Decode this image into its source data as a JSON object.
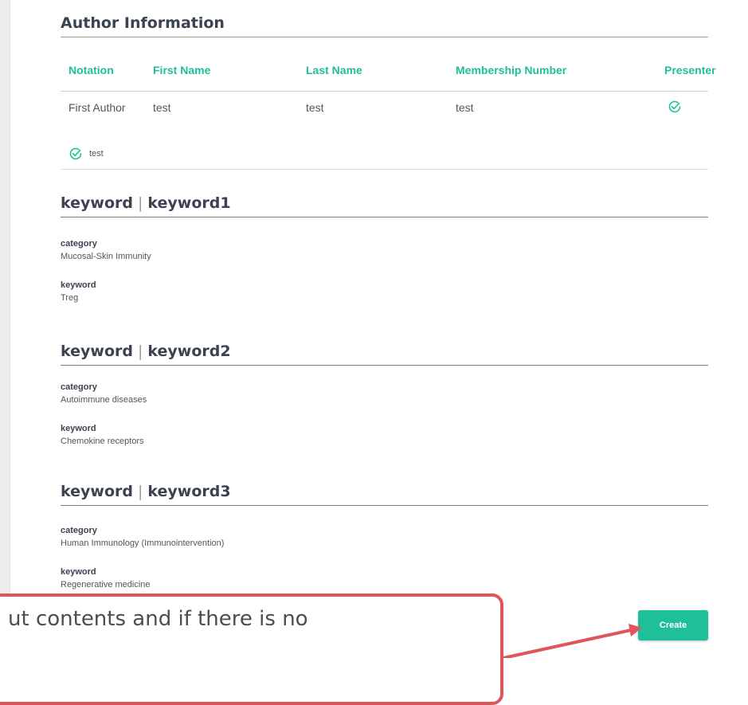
{
  "author_section": {
    "title": "Author Information",
    "columns": [
      "Notation",
      "First Name",
      "Last Name",
      "Membership Number",
      "Presenter"
    ],
    "rows": [
      {
        "notation": "First Author",
        "first_name": "test",
        "last_name": "test",
        "membership_number": "test",
        "presenter_icon": "check-circle-icon"
      }
    ],
    "consent": {
      "icon": "check-circle-icon",
      "text": "test"
    }
  },
  "keywords": [
    {
      "prefix": "keyword",
      "separator": "|",
      "name": "keyword1",
      "category_label": "category",
      "category_value": "Mucosal-Skin Immunity",
      "keyword_label": "keyword",
      "keyword_value": "Treg"
    },
    {
      "prefix": "keyword",
      "separator": "|",
      "name": "keyword2",
      "category_label": "category",
      "category_value": "Autoimmune diseases",
      "keyword_label": "keyword",
      "keyword_value": "Chemokine receptors"
    },
    {
      "prefix": "keyword",
      "separator": "|",
      "name": "keyword3",
      "category_label": "category",
      "category_value": "Human Immunology (Immunointervention)",
      "keyword_label": "keyword",
      "keyword_value": "Regenerative medicine"
    }
  ],
  "actions": {
    "create_label": "Create"
  },
  "annotation": {
    "text": "ut contents and if there is no"
  },
  "colors": {
    "accent": "#1fbf9a",
    "heading": "#3b4250",
    "callout": "#e0555c"
  }
}
